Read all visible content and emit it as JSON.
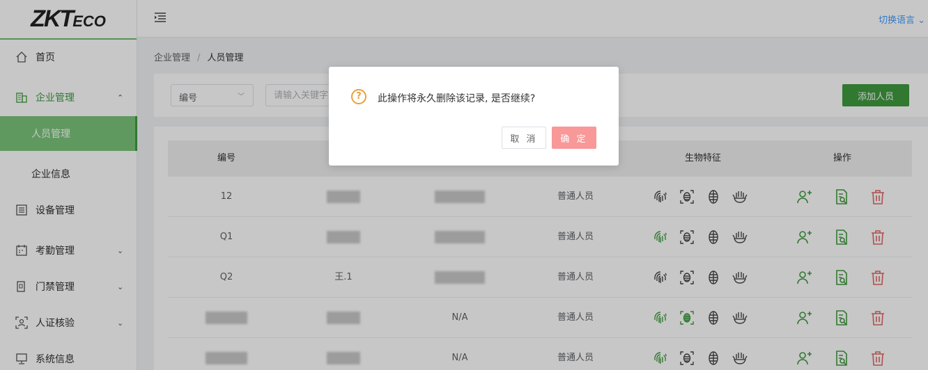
{
  "brand": {
    "logo_main": "ZKT",
    "logo_sub": "ECO"
  },
  "header": {
    "language_label": "切换语言"
  },
  "sidebar": {
    "items": [
      {
        "label": "首页",
        "icon": "home-icon"
      },
      {
        "label": "企业管理",
        "icon": "building-icon",
        "expanded": true
      },
      {
        "label": "人员管理",
        "sub": true,
        "active": true
      },
      {
        "label": "企业信息",
        "sub": true
      },
      {
        "label": "设备管理",
        "icon": "device-icon"
      },
      {
        "label": "考勤管理",
        "icon": "calendar-icon"
      },
      {
        "label": "门禁管理",
        "icon": "door-icon"
      },
      {
        "label": "人证核验",
        "icon": "id-verify-icon"
      },
      {
        "label": "系统信息",
        "icon": "monitor-icon"
      }
    ]
  },
  "breadcrumb": {
    "parent": "企业管理",
    "separator": "/",
    "current": "人员管理"
  },
  "search": {
    "select_value": "编号",
    "keyword_placeholder": "请输入关键字",
    "add_button": "添加人员"
  },
  "table": {
    "headers": {
      "id": "编号",
      "biometrics": "生物特征",
      "actions": "操作"
    },
    "rows": [
      {
        "id": "12",
        "name": "",
        "col3": "",
        "role": "普通人员",
        "bio_active": [
          false,
          false,
          false,
          false
        ]
      },
      {
        "id": "Q1",
        "name": "",
        "col3": "",
        "role": "普通人员",
        "bio_active": [
          true,
          false,
          false,
          false
        ]
      },
      {
        "id": "Q2",
        "name": "王.1",
        "col3": "",
        "role": "普通人员",
        "bio_active": [
          false,
          false,
          false,
          false
        ]
      },
      {
        "id": "",
        "name": "",
        "col3": "N/A",
        "role": "普通人员",
        "bio_active": [
          true,
          true,
          false,
          false
        ]
      },
      {
        "id": "",
        "name": "",
        "col3": "N/A",
        "role": "普通人员",
        "bio_active": [
          true,
          false,
          false,
          false
        ]
      }
    ]
  },
  "dialog": {
    "message": "此操作将永久删除该记录, 是否继续?",
    "icon_text": "?",
    "cancel": "取 消",
    "confirm": "确 定"
  },
  "colors": {
    "primary_green": "#3f9a3f",
    "menu_active": "#7cc47c",
    "warning": "#e6a23c",
    "danger": "#e06666",
    "confirm_btn": "#f89898",
    "lang_link": "#409eff"
  }
}
